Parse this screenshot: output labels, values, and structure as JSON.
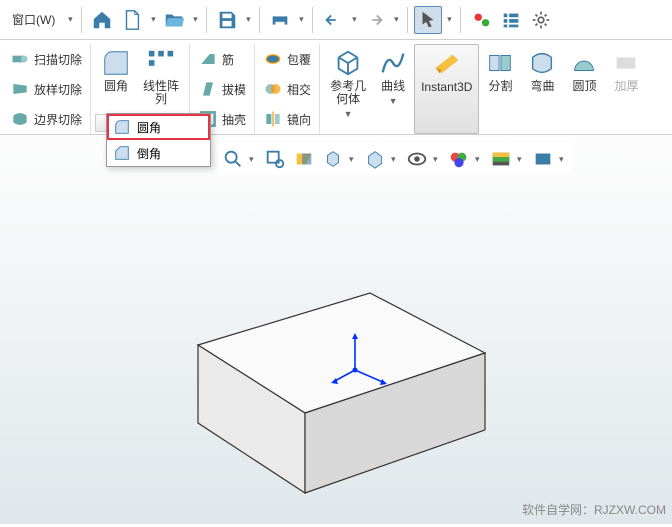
{
  "menu": {
    "window": "窗口(W)"
  },
  "ribbon": {
    "col1": {
      "r1": "扫描切除",
      "r2": "放样切除",
      "r3": "边界切除"
    },
    "col2": {
      "big1": "圆角",
      "big2": "线性阵\n列"
    },
    "col3": {
      "r1": "筋",
      "r2": "拔模",
      "r3": "抽壳"
    },
    "col4": {
      "r1": "包覆",
      "r2": "相交",
      "r3": "镜向"
    },
    "col5": {
      "big1": "参考几\n何体",
      "big2": "曲线",
      "big3": "Instant3D",
      "big4": "分割",
      "big5": "弯曲",
      "big6": "圆顶",
      "big7": "加厚"
    }
  },
  "flyout": {
    "i1": "圆角",
    "i2": "倒角"
  },
  "footer": {
    "watermark": "软件自学网：RJZXW.COM"
  }
}
